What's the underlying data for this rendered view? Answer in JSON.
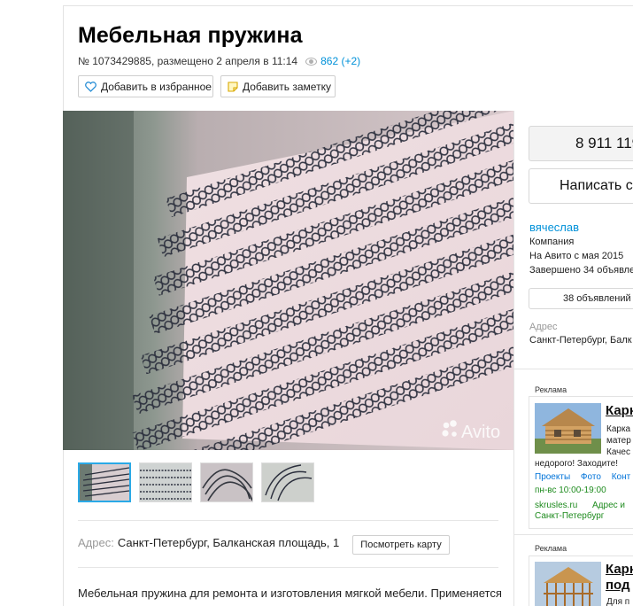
{
  "listing": {
    "title": "Мебельная пружина",
    "meta_text": "№ 1073429885, размещено 2 апреля в 11:14",
    "views": "862 (+2)",
    "favorite_label": "Добавить в избранное",
    "note_label": "Добавить заметку",
    "watermark": "Avito"
  },
  "address": {
    "label": "Адрес:",
    "value": "Санкт-Петербург, Балканская площадь, 1",
    "map_button": "Посмотреть карту"
  },
  "description": "Мебельная пружина для ремонта и изготовления мягкой мебели. Применяется",
  "seller": {
    "phone": "8 911 119",
    "write_button": "Написать с",
    "name": "вячеслав",
    "type": "Компания",
    "since": "На Авито с мая 2015",
    "completed": "Завершено 34 объявле",
    "ads_button": "38 объявлений",
    "address_label": "Адрес",
    "address_value": "Санкт-Петербург, Балк"
  },
  "ad1": {
    "label": "Реклама",
    "title": "Карк",
    "line1": "Карка",
    "line2": "матер",
    "line3": "Качес",
    "line4": "недорого! Заходите!",
    "links": [
      "Проекты",
      "Фото",
      "Конт"
    ],
    "hours": "пн-вс 10:00-19:00",
    "domain": "skrusles.ru",
    "addr_link": "Адрес и",
    "city": "Санкт-Петербург"
  },
  "ad2": {
    "label": "Реклама",
    "title1": "Карк",
    "title2": "под",
    "line1": "Для п"
  }
}
